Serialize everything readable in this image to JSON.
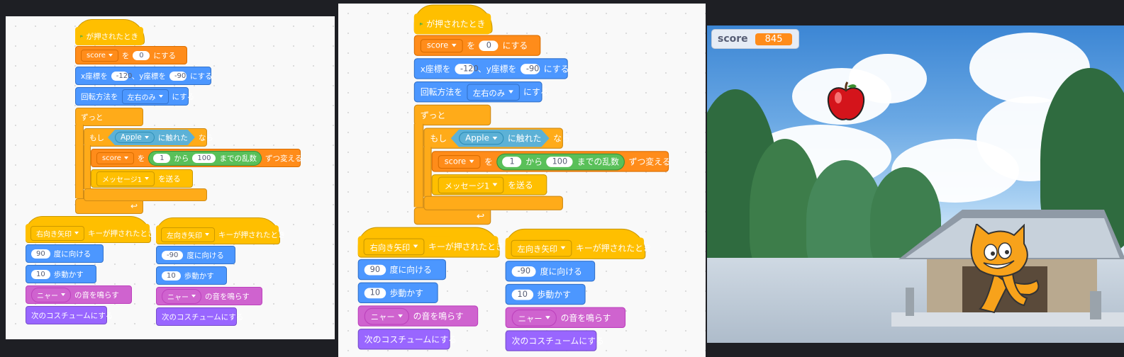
{
  "blocks": {
    "when_flag": "が押されたとき",
    "score_var": "score",
    "set_wo": "を",
    "set_val": "0",
    "nisuru": "にする",
    "goto_x": "x座標を",
    "goto_x_val": "-120",
    "goto_y": "、y座標を",
    "goto_y_val": "-90",
    "rot_label": "回転方法を",
    "rot_val": "左右のみ",
    "forever": "ずっと",
    "if_label": "もし",
    "sprite": "Apple",
    "touching": "に触れた",
    "then": "なら",
    "change_from": "1",
    "kara": "から",
    "change_to": "100",
    "random": "までの乱数",
    "change_by": "ずつ変える",
    "message": "メッセージ1",
    "broadcast": "を送る",
    "right_key": "右向き矢印",
    "left_key": "左向き矢印",
    "key_pressed": "キーが押されたとき",
    "dir_right": "90",
    "dir_left": "-90",
    "point_dir": "度に向ける",
    "steps": "10",
    "move": "歩動かす",
    "sound": "ニャー",
    "play_sound": "の音を鳴らす",
    "next_costume": "次のコスチュームにする"
  },
  "stage": {
    "monitor_label": "score",
    "monitor_value": "845"
  },
  "colors": {
    "events": "#ffbf00",
    "variables": "#ff8c1a",
    "motion": "#4c97ff",
    "sound": "#cf63cf",
    "looks": "#9966ff",
    "control": "#ffab19",
    "sensing": "#5cb1d6",
    "operators": "#59c059"
  }
}
